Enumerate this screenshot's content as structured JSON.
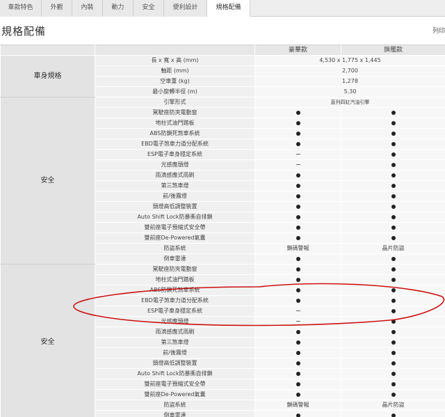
{
  "tabs": [
    {
      "label": "車款特色",
      "width": 60,
      "active": false
    },
    {
      "label": "外觀",
      "width": 44,
      "active": false
    },
    {
      "label": "內裝",
      "width": 44,
      "active": false
    },
    {
      "label": "動力",
      "width": 44,
      "active": false
    },
    {
      "label": "安全",
      "width": 44,
      "active": false
    },
    {
      "label": "便利設計",
      "width": 62,
      "active": false
    },
    {
      "label": "規格配備",
      "width": 62,
      "active": true
    }
  ],
  "page_title": "規格配備",
  "print_label": "列印",
  "columns": {
    "trim_a": "豪華款",
    "trim_b": "旗艦款"
  },
  "sections": [
    {
      "category": "車身規格",
      "rows": [
        {
          "label": "長 x 寬 x 高 (mm)",
          "merged": "4,530 x 1,775 x 1,445"
        },
        {
          "label": "軸距 (mm)",
          "merged": "2,700"
        },
        {
          "label": "空車重 (kg)",
          "merged": "1,278"
        },
        {
          "label": "最小旋轉半徑 (m)",
          "merged": "5.30"
        }
      ]
    },
    {
      "category": "安全",
      "rows": [
        {
          "label": "引擎形式",
          "merged": "直列四缸汽油引擎"
        },
        {
          "label": "駕駛座防夾電動窗",
          "a": "dot",
          "b": "dot"
        },
        {
          "label": "地柱式油門踏板",
          "a": "dot",
          "b": "dot"
        },
        {
          "label": "ABS防鎖死煞車系統",
          "a": "dot",
          "b": "dot"
        },
        {
          "label": "EBD電子煞車力道分配系統",
          "a": "dot",
          "b": "dot"
        },
        {
          "label": "ESP電子車身穩定系統",
          "a": "dash",
          "b": "dot"
        },
        {
          "label": "光感應頭燈",
          "a": "dash",
          "b": "dot"
        },
        {
          "label": "雨滴感應式雨刷",
          "a": "dot",
          "b": "dot"
        },
        {
          "label": "第三煞車燈",
          "a": "dot",
          "b": "dot"
        },
        {
          "label": "前/後霧燈",
          "a": "dot",
          "b": "dot"
        },
        {
          "label": "頭燈高低調整裝置",
          "a": "dot",
          "b": "dot"
        },
        {
          "label": "Auto Shift Lock防暴衝自排鎖",
          "a": "dot",
          "b": "dot"
        },
        {
          "label": "雙前座電子預縮式安全帶",
          "a": "dot",
          "b": "dot"
        },
        {
          "label": "雙前座De-Powered氣囊",
          "a": "dot",
          "b": "dot"
        },
        {
          "label": "防盜系統",
          "a_text": "鎖碼警報",
          "b_text": "晶片防盜"
        },
        {
          "label": "倒車雷達",
          "a": "dot",
          "b": "dot"
        }
      ]
    },
    {
      "category": "安全",
      "rows": [
        {
          "label": "駕駛座防夾電動窗",
          "a": "dot",
          "b": "dot"
        },
        {
          "label": "地柱式油門踏板",
          "a": "dot",
          "b": "dot"
        },
        {
          "label": "ABS防鎖死煞車系統",
          "a": "dot",
          "b": "dot"
        },
        {
          "label": "EBD電子煞車力道分配系統",
          "a": "dot",
          "b": "dot"
        },
        {
          "label": "ESP電子車身穩定系統",
          "a": "dash",
          "b": "dot"
        },
        {
          "label": "光感應頭燈",
          "a": "dash",
          "b": "dot"
        },
        {
          "label": "雨滴感應式雨刷",
          "a": "dot",
          "b": "dot"
        },
        {
          "label": "第三煞車燈",
          "a": "dot",
          "b": "dot"
        },
        {
          "label": "前/後霧燈",
          "a": "dot",
          "b": "dot"
        },
        {
          "label": "頭燈高低調整裝置",
          "a": "dot",
          "b": "dot"
        },
        {
          "label": "Auto Shift Lock防暴衝自排鎖",
          "a": "dot",
          "b": "dot"
        },
        {
          "label": "雙前座電子預縮式安全帶",
          "a": "dot",
          "b": "dot"
        },
        {
          "label": "雙前座De-Powered氣囊",
          "a": "dot",
          "b": "dot"
        },
        {
          "label": "防盜系統",
          "a_text": "鎖碼警報",
          "b_text": "晶片防盜"
        },
        {
          "label": "倒車雷達",
          "a": "dot",
          "b": "dot"
        }
      ]
    }
  ],
  "highlight_color": "#cc1111"
}
